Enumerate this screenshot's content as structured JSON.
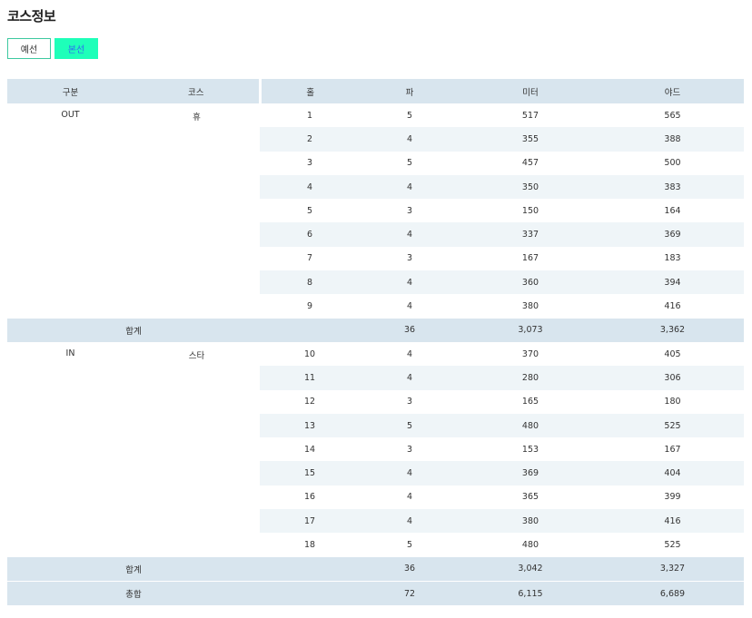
{
  "page": {
    "title": "코스정보"
  },
  "tabs": [
    {
      "label": "예선",
      "active": false
    },
    {
      "label": "본선",
      "active": true
    }
  ],
  "colors": {
    "accent": "#1effb9",
    "accent_text": "#2f6cf0",
    "header_bg": "#d8e5ee",
    "row_alt_bg": "#eff5f8"
  },
  "table": {
    "headers": {
      "division": "구분",
      "course": "코스",
      "hole": "홀",
      "par": "파",
      "meter": "미터",
      "yard": "야드"
    },
    "sections": [
      {
        "division": "OUT",
        "course": "휴",
        "holes": [
          {
            "hole": "1",
            "par": "5",
            "meter": "517",
            "yard": "565"
          },
          {
            "hole": "2",
            "par": "4",
            "meter": "355",
            "yard": "388"
          },
          {
            "hole": "3",
            "par": "5",
            "meter": "457",
            "yard": "500"
          },
          {
            "hole": "4",
            "par": "4",
            "meter": "350",
            "yard": "383"
          },
          {
            "hole": "5",
            "par": "3",
            "meter": "150",
            "yard": "164"
          },
          {
            "hole": "6",
            "par": "4",
            "meter": "337",
            "yard": "369"
          },
          {
            "hole": "7",
            "par": "3",
            "meter": "167",
            "yard": "183"
          },
          {
            "hole": "8",
            "par": "4",
            "meter": "360",
            "yard": "394"
          },
          {
            "hole": "9",
            "par": "4",
            "meter": "380",
            "yard": "416"
          }
        ],
        "subtotal": {
          "label": "합계",
          "par": "36",
          "meter": "3,073",
          "yard": "3,362"
        }
      },
      {
        "division": "IN",
        "course": "스타",
        "holes": [
          {
            "hole": "10",
            "par": "4",
            "meter": "370",
            "yard": "405"
          },
          {
            "hole": "11",
            "par": "4",
            "meter": "280",
            "yard": "306"
          },
          {
            "hole": "12",
            "par": "3",
            "meter": "165",
            "yard": "180"
          },
          {
            "hole": "13",
            "par": "5",
            "meter": "480",
            "yard": "525"
          },
          {
            "hole": "14",
            "par": "3",
            "meter": "153",
            "yard": "167"
          },
          {
            "hole": "15",
            "par": "4",
            "meter": "369",
            "yard": "404"
          },
          {
            "hole": "16",
            "par": "4",
            "meter": "365",
            "yard": "399"
          },
          {
            "hole": "17",
            "par": "4",
            "meter": "380",
            "yard": "416"
          },
          {
            "hole": "18",
            "par": "5",
            "meter": "480",
            "yard": "525"
          }
        ],
        "subtotal": {
          "label": "합계",
          "par": "36",
          "meter": "3,042",
          "yard": "3,327"
        }
      }
    ],
    "total": {
      "label": "총합",
      "par": "72",
      "meter": "6,115",
      "yard": "6,689"
    }
  }
}
